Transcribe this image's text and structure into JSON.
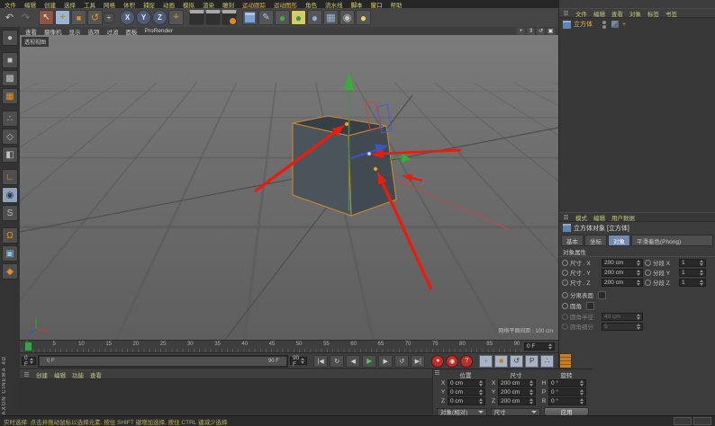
{
  "menubar": {
    "items": [
      "文件",
      "编辑",
      "创建",
      "选择",
      "工具",
      "网格",
      "体积",
      "捕捉",
      "动画",
      "模拟",
      "渲染",
      "雕刻",
      "运动跟踪",
      "运动图形",
      "角色",
      "流水线",
      "脚本",
      "窗口",
      "帮助"
    ]
  },
  "toolbar": {
    "icons": [
      {
        "name": "undo",
        "glyph": "↶"
      },
      {
        "name": "redo",
        "glyph": "↷"
      },
      {
        "name": "live-selection",
        "glyph": "↖"
      },
      {
        "name": "move",
        "glyph": "+"
      },
      {
        "name": "scale",
        "glyph": "■"
      },
      {
        "name": "rotate",
        "glyph": "↺"
      },
      {
        "name": "last-tool",
        "glyph": "+"
      },
      {
        "name": "lock-x",
        "glyph": "X"
      },
      {
        "name": "lock-y",
        "glyph": "Y"
      },
      {
        "name": "lock-z",
        "glyph": "Z"
      },
      {
        "name": "coordinate-system",
        "glyph": "⌖"
      },
      {
        "name": "render-view",
        "glyph": ""
      },
      {
        "name": "render-picture-viewer",
        "glyph": ""
      },
      {
        "name": "render-settings",
        "glyph": ""
      },
      {
        "name": "primitive-cube",
        "glyph": ""
      },
      {
        "name": "spline-pen",
        "glyph": "✎"
      },
      {
        "name": "subdivision-surface",
        "glyph": "●"
      },
      {
        "name": "deformer",
        "glyph": "●"
      },
      {
        "name": "environment",
        "glyph": "●"
      },
      {
        "name": "instance-array",
        "glyph": "▦"
      },
      {
        "name": "camera",
        "glyph": "◉"
      },
      {
        "name": "light",
        "glyph": "●"
      }
    ]
  },
  "left_toolbar": {
    "icons": [
      {
        "name": "make-editable",
        "glyph": "●"
      },
      {
        "name": "model-mode",
        "glyph": "■"
      },
      {
        "name": "texture-mode",
        "glyph": "▩"
      },
      {
        "name": "workplane-mode",
        "glyph": "▦"
      },
      {
        "name": "points-mode",
        "glyph": "∴"
      },
      {
        "name": "edges-mode",
        "glyph": "◇"
      },
      {
        "name": "polygons-mode",
        "glyph": "◧"
      },
      {
        "name": "enable-axis",
        "glyph": "∟"
      },
      {
        "name": "viewport-solo",
        "glyph": "◉"
      },
      {
        "name": "snap-settings",
        "glyph": "S"
      },
      {
        "name": "enable-snap",
        "glyph": "Ω"
      },
      {
        "name": "workplane",
        "glyph": "▣"
      },
      {
        "name": "lock-workplane",
        "glyph": "◆"
      }
    ]
  },
  "viewport": {
    "menu": [
      "查看",
      "摄像机",
      "显示",
      "选项",
      "过滤",
      "面板",
      "ProRender"
    ],
    "corner_icons": [
      {
        "name": "pan-view",
        "glyph": "+"
      },
      {
        "name": "dolly-view",
        "glyph": "⇕"
      },
      {
        "name": "rotate-view",
        "glyph": "↺"
      },
      {
        "name": "toggle-views",
        "glyph": "▣"
      }
    ],
    "view_label": "透视视图",
    "grid_hint": "网格平面间距 : 100 cm"
  },
  "object_manager": {
    "menu": [
      "文件",
      "编辑",
      "查看",
      "对象",
      "标签",
      "书签"
    ],
    "objects": [
      {
        "label": "立方体"
      }
    ]
  },
  "attribute_manager": {
    "menu": [
      "模式",
      "编辑",
      "用户数据"
    ],
    "title": "立方体对象 [立方体]",
    "tabs": [
      "基本",
      "坐标",
      "对象",
      "平滑着色(Phong)"
    ],
    "section": "对象属性",
    "fields": [
      {
        "label": "尺寸 . X",
        "value": "200 cm",
        "label2": "分段 X",
        "value2": "1"
      },
      {
        "label": "尺寸 . Y",
        "value": "200 cm",
        "label2": "分段 Y",
        "value2": "1"
      },
      {
        "label": "尺寸 . Z",
        "value": "200 cm",
        "label2": "分段 Z",
        "value2": "1"
      }
    ],
    "checkboxes": [
      {
        "label": "分离表面"
      },
      {
        "label": "圆角"
      }
    ],
    "disabled_fields": [
      {
        "label": "圆角半径",
        "value": "40 cm"
      },
      {
        "label": "圆角细分",
        "value": "5"
      }
    ]
  },
  "timeline": {
    "ticks": [
      "0",
      "5",
      "10",
      "15",
      "20",
      "25",
      "30",
      "35",
      "40",
      "45",
      "50",
      "55",
      "60",
      "65",
      "70",
      "75",
      "80",
      "85",
      "90"
    ],
    "current_frame": "0 F"
  },
  "transport": {
    "start_field": "0 F",
    "end_field": "90 F",
    "range_start_label": "0 F",
    "range_end_label": "90 F",
    "buttons": [
      {
        "name": "goto-start",
        "glyph": "|◀"
      },
      {
        "name": "play-backwards",
        "glyph": "↻"
      },
      {
        "name": "previous-frame",
        "glyph": "◀"
      },
      {
        "name": "play",
        "glyph": "▶"
      },
      {
        "name": "next-frame",
        "glyph": "▶"
      },
      {
        "name": "loop",
        "glyph": "↺"
      },
      {
        "name": "goto-end",
        "glyph": "▶|"
      }
    ],
    "record_buttons": [
      {
        "name": "record-keyframe",
        "glyph": "●"
      },
      {
        "name": "autokeying",
        "glyph": "◉"
      },
      {
        "name": "record-options",
        "glyph": "?"
      }
    ],
    "toggles": [
      {
        "name": "key-position",
        "glyph": "+"
      },
      {
        "name": "key-scale",
        "glyph": "■"
      },
      {
        "name": "key-rotation",
        "glyph": "↺"
      },
      {
        "name": "key-parameter",
        "glyph": "P"
      },
      {
        "name": "key-pla",
        "glyph": "∴"
      }
    ]
  },
  "coordinates_panel": {
    "headers": [
      "位置",
      "尺寸",
      "旋转"
    ],
    "pos_rows": [
      {
        "axis": "X",
        "value": "0 cm"
      },
      {
        "axis": "Y",
        "value": "0 cm"
      },
      {
        "axis": "Z",
        "value": "0 cm"
      }
    ],
    "size_rows": [
      {
        "axis": "X",
        "value": "200 cm"
      },
      {
        "axis": "Y",
        "value": "200 cm"
      },
      {
        "axis": "Z",
        "value": "200 cm"
      }
    ],
    "rot_rows": [
      {
        "axis": "H",
        "value": "0 °"
      },
      {
        "axis": "P",
        "value": "0 °"
      },
      {
        "axis": "B",
        "value": "0 °"
      }
    ],
    "mode_dropdown": "对象(相对)",
    "size_dropdown": "尺寸",
    "apply_button": "应用"
  },
  "material_manager": {
    "menu": [
      "创建",
      "编辑",
      "功能",
      "查看"
    ]
  },
  "status_bar": {
    "hint": "实时选择: 点击并拖动鼠标以选择元素. 按住 SHIFT 键增加选择, 按住 CTRL 键减少选择"
  },
  "brand": "MAXON CINEMA 4D"
}
